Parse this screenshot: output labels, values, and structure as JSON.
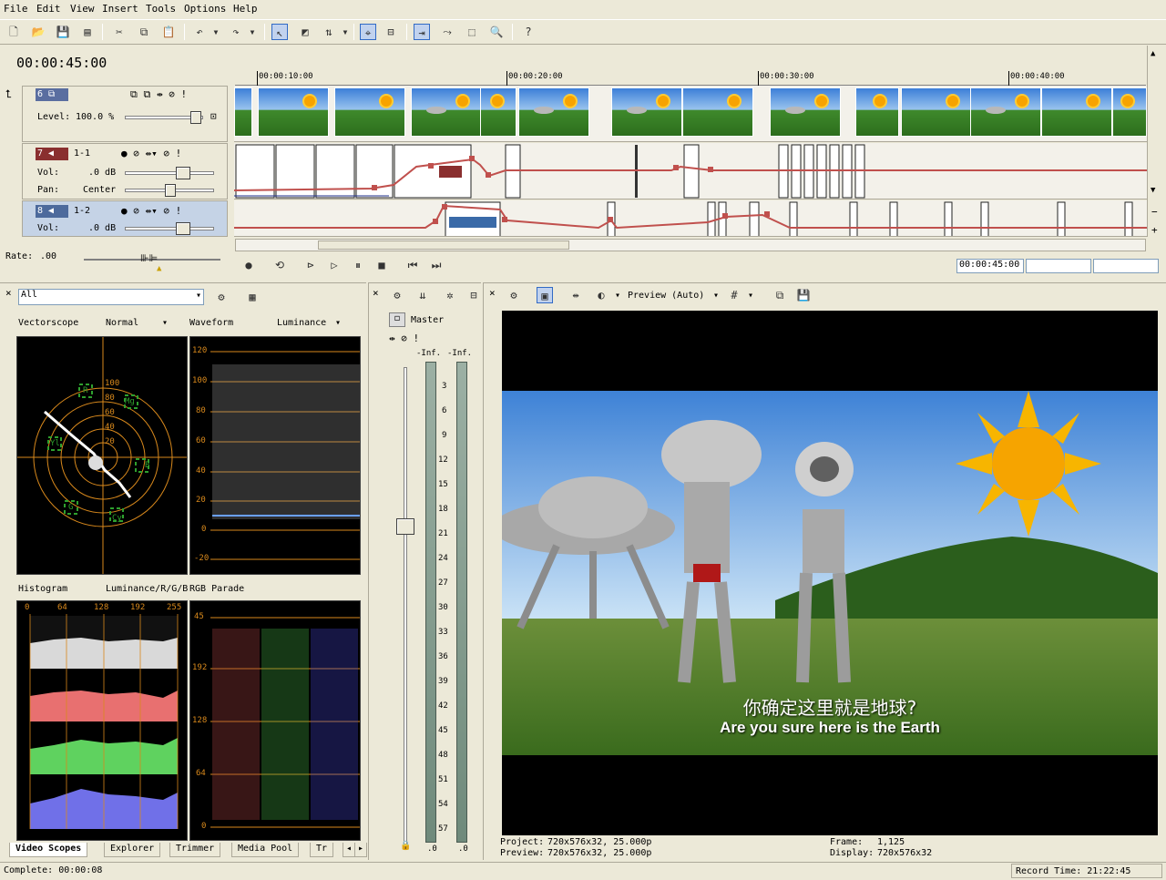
{
  "menu": [
    "File",
    "Edit",
    "View",
    "Insert",
    "Tools",
    "Options",
    "Help"
  ],
  "toolbar_icons": [
    "new-icon",
    "open-icon",
    "save-icon",
    "properties-icon",
    "cut-icon",
    "copy-icon",
    "paste-icon",
    "undo-icon",
    "redo-icon",
    "normal-edit-tool-icon",
    "envelope-tool-icon",
    "selection-tool-icon",
    "snap-icon",
    "auto-ripple-icon",
    "lock-envelopes-icon",
    "zoom-tool-icon",
    "what-is-this-icon"
  ],
  "timeline": {
    "current_time": "00:00:45:00",
    "ruler_labels": [
      "00:00:10:00",
      "00:00:20:00",
      "00:00:30:00",
      "00:00:40:00"
    ],
    "rate_label": "Rate:",
    "rate_value": ".00",
    "end_time": "00:00:45:00"
  },
  "tracks": [
    {
      "num": "6",
      "label_level": "Level:",
      "level_value": "100.0 %",
      "color": "#5a6ea0"
    },
    {
      "num": "7",
      "name": "1-1",
      "vol_label": "Vol:",
      "vol_value": ".0 dB",
      "pan_label": "Pan:",
      "pan_value": "Center",
      "color": "#8a2f2f"
    },
    {
      "num": "8",
      "name": "1-2",
      "vol_label": "Vol:",
      "vol_value": ".0 dB",
      "color": "#4d6a9c"
    }
  ],
  "scopes": {
    "filter": "All",
    "vectorscope_label": "Vectorscope",
    "vectorscope_mode": "Normal",
    "waveform_label": "Waveform",
    "waveform_mode": "Luminance",
    "vector_rings": [
      "100",
      "80",
      "60",
      "40",
      "20"
    ],
    "vector_targets": [
      "R",
      "Mg",
      "B",
      "Cy",
      "G",
      "Yl"
    ],
    "waveform_ticks": [
      "120",
      "100",
      "80",
      "60",
      "40",
      "20",
      "0",
      "-20"
    ],
    "histogram_label": "Histogram",
    "histogram_mode": "Luminance/R/G/B",
    "parade_label": "RGB Parade",
    "histogram_ticks": [
      "0",
      "64",
      "128",
      "192",
      "255"
    ],
    "parade_ticks": [
      "45",
      "192",
      "128",
      "64",
      "0"
    ]
  },
  "tabs": [
    "Video Scopes",
    "Explorer",
    "Trimmer",
    "Media Pool",
    "Tr"
  ],
  "mixer": {
    "master_label": "Master",
    "inf_left": "-Inf.",
    "inf_right": "-Inf.",
    "scale": [
      "3",
      "6",
      "9",
      "12",
      "15",
      "18",
      "21",
      "24",
      "27",
      "30",
      "33",
      "36",
      "39",
      "42",
      "45",
      "48",
      "51",
      "54",
      "57"
    ],
    "bottom_left": ".0",
    "bottom_right": ".0"
  },
  "preview": {
    "mode_label": "Preview (Auto)",
    "subtitle_cn": "你确定这里就是地球?",
    "subtitle_en": "Are you sure here is the Earth",
    "project_label": "Project:",
    "project_value": "720x576x32, 25.000p",
    "preview_label": "Preview:",
    "preview_value": "720x576x32, 25.000p",
    "frame_label": "Frame:",
    "frame_value": "1,125",
    "display_label": "Display:",
    "display_value": "720x576x32"
  },
  "status": {
    "complete": "Complete: 00:00:08",
    "record_time": "Record Time: 21:22:45"
  }
}
